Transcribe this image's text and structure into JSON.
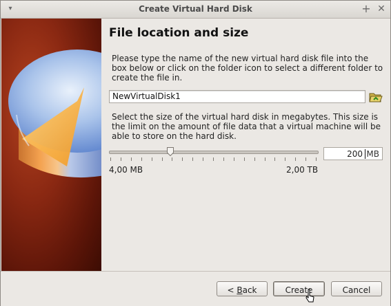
{
  "window": {
    "title": "Create Virtual Hard Disk"
  },
  "page": {
    "heading": "File location and size",
    "location_text": "Please type the name of the new virtual hard disk file into the box below or click on the folder icon to select a different folder to create the file in.",
    "file_name": "NewVirtualDisk1",
    "size_text": "Select the size of the virtual hard disk in megabytes. This size is the limit on the amount of file data that a virtual machine will be able to store on the hard disk.",
    "slider": {
      "min_label": "4,00 MB",
      "max_label": "2,00 TB"
    },
    "size_value": "200",
    "size_unit": "MB"
  },
  "buttons": {
    "back_prefix": "< ",
    "back_mnemonic": "B",
    "back_rest": "ack",
    "create": "Create",
    "cancel": "Cancel"
  },
  "icons": {
    "folder": "folder-open-icon",
    "maximize": "plus-icon",
    "close": "close-icon",
    "menu": "window-menu-icon"
  }
}
